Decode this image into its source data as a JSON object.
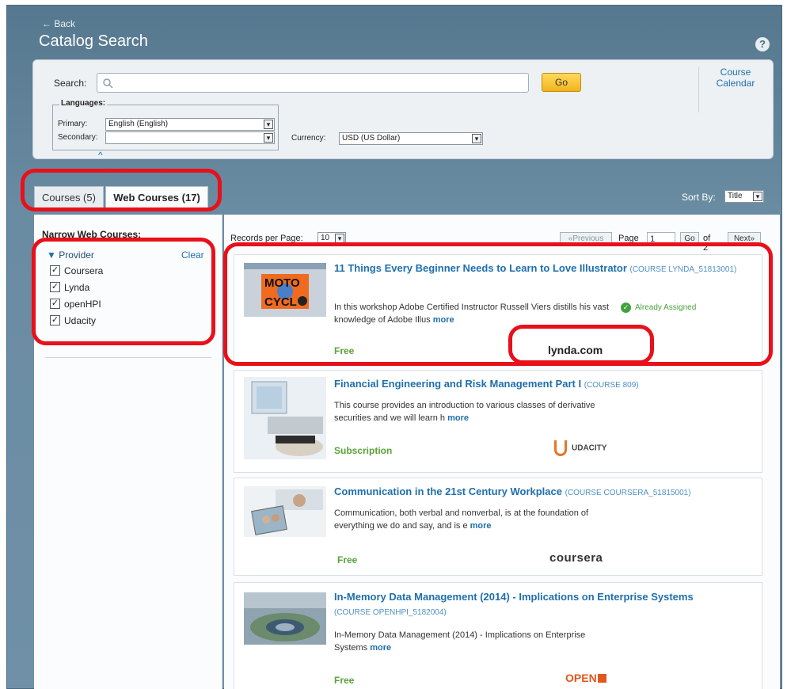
{
  "header": {
    "back_label": "← Back",
    "title": "Catalog Search",
    "help_icon": "?"
  },
  "search": {
    "label": "Search:",
    "placeholder": "",
    "go_label": "Go",
    "course_calendar": "Course Calendar"
  },
  "languages": {
    "legend": "Languages:",
    "primary_label": "Primary:",
    "primary_value": "English (English)",
    "secondary_label": "Secondary:",
    "secondary_value": "",
    "currency_label": "Currency:",
    "currency_value": "USD (US Dollar)"
  },
  "tabs": [
    {
      "label": "Courses (5)",
      "active": false
    },
    {
      "label": "Web Courses (17)",
      "active": true
    }
  ],
  "sort": {
    "label": "Sort By:",
    "value": "Title"
  },
  "sidebar": {
    "title": "Narrow Web Courses:",
    "provider_label": "Provider",
    "clear_label": "Clear",
    "providers": [
      {
        "label": "Coursera",
        "checked": true
      },
      {
        "label": "Lynda",
        "checked": true
      },
      {
        "label": "openHPI",
        "checked": true
      },
      {
        "label": "Udacity",
        "checked": true
      }
    ]
  },
  "pagination": {
    "records_label": "Records per Page:",
    "records_value": "10",
    "previous_label": "«Previous",
    "page_label": "Page",
    "page_value": "1",
    "go_label": "Go",
    "of_label": "of 2",
    "next_label": "Next»"
  },
  "courses": [
    {
      "title": "11 Things Every Beginner Needs to Learn to Love Illustrator",
      "code": "(COURSE LYNDA_51813001)",
      "description": "In this workshop Adobe Certified Instructor Russell Viers distills his vast knowledge of Adobe Illus",
      "more": "more",
      "price": "Free",
      "status": "Already Assigned",
      "provider_logo": "lynda.com"
    },
    {
      "title": "Financial Engineering and Risk Management Part I",
      "code": "(COURSE 809)",
      "description": "This course provides an introduction to various classes of derivative securities and we will learn h",
      "more": "more",
      "price": "Subscription",
      "provider_logo": "UDACITY"
    },
    {
      "title": "Communication in the 21st Century Workplace",
      "code": "(COURSE COURSERA_51815001)",
      "description": "Communication, both verbal and nonverbal, is at the foundation of everything we do and say, and is e",
      "more": "more",
      "price": "Free",
      "provider_logo": "coursera"
    },
    {
      "title": "In-Memory Data Management (2014) - Implications on Enterprise Systems",
      "code": "(COURSE OPENHPI_5182004)",
      "description": "In-Memory Data Management (2014) - Implications on Enterprise Systems",
      "more": "more",
      "price": "Free",
      "provider_logo": "OPEN"
    }
  ],
  "thumbnail_text": {
    "moto": "MOTO",
    "cycle": "CYCL"
  },
  "colors": {
    "accent": "#1f6fae",
    "price_green": "#5aa13a",
    "annotation_red": "#e8101a",
    "header_bg": "#56788f"
  }
}
